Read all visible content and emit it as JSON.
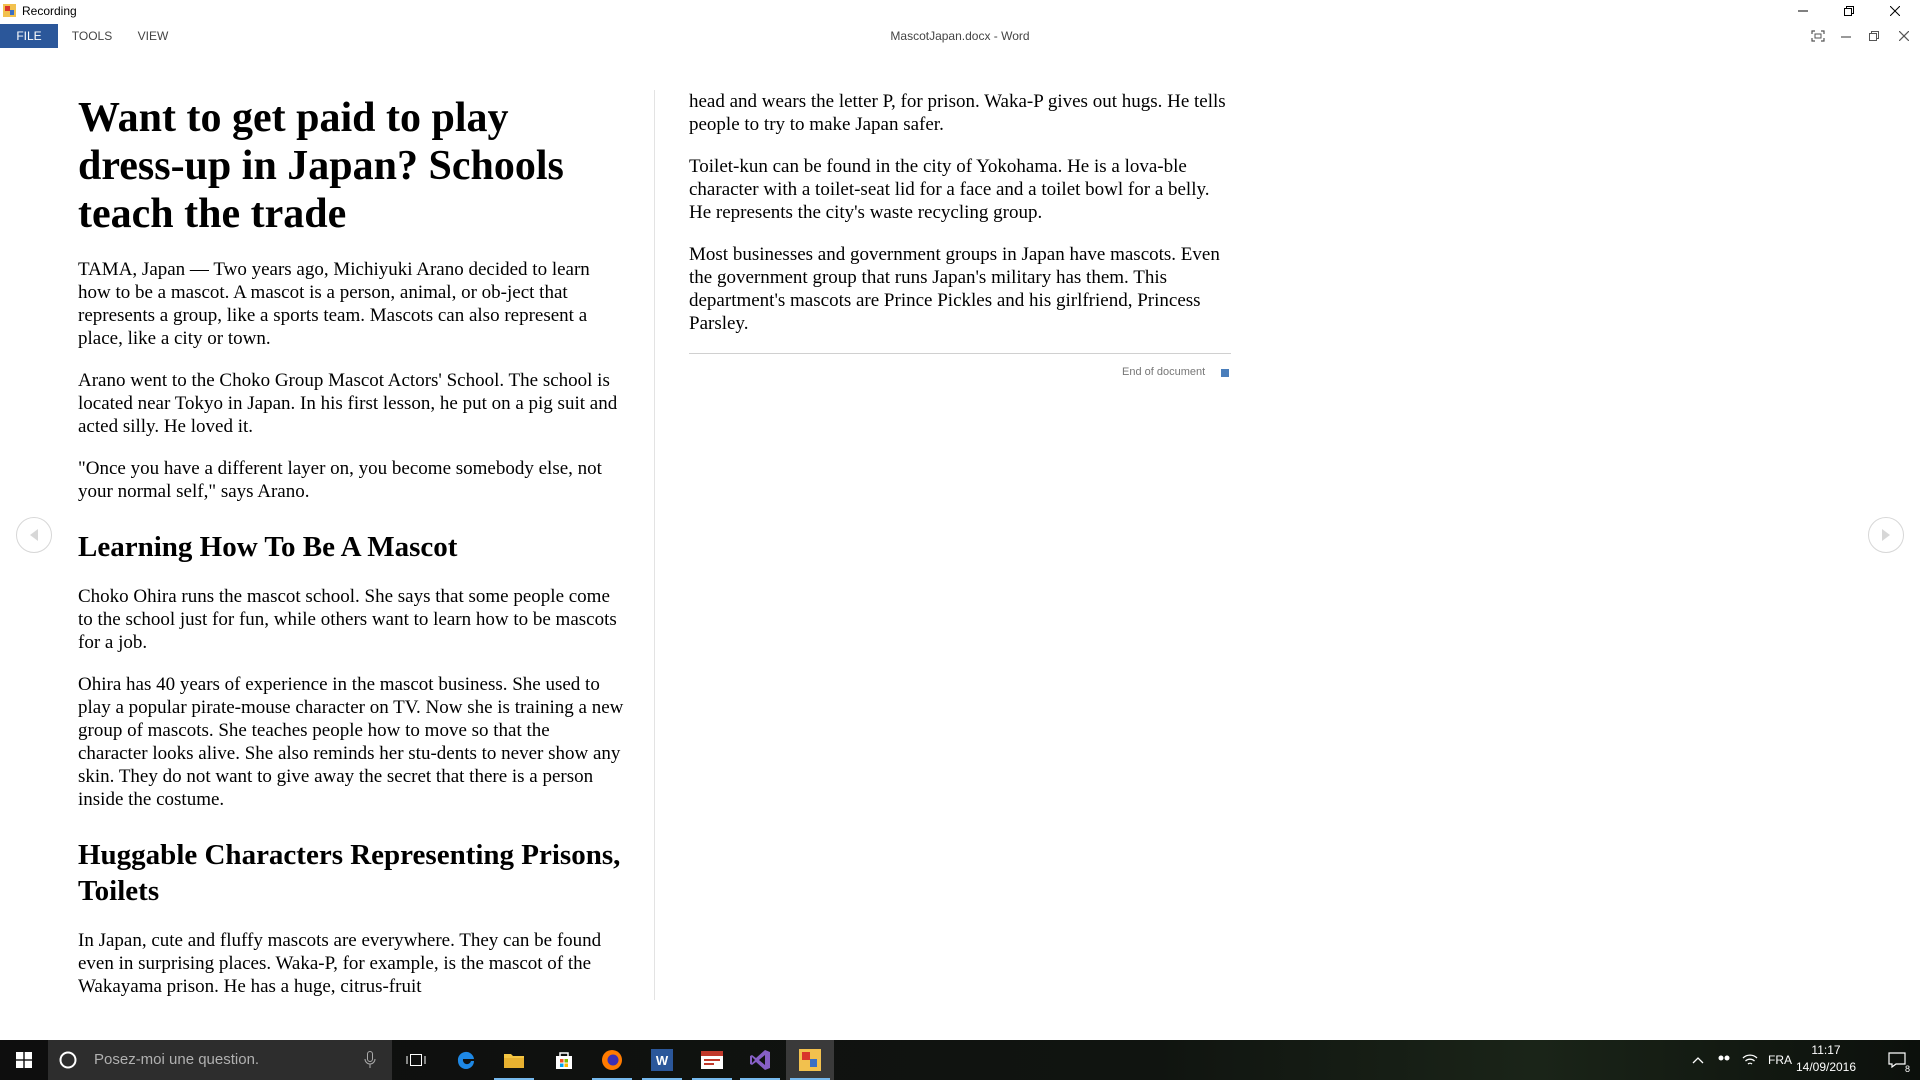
{
  "recording_window": {
    "title": "Recording"
  },
  "menu": {
    "file": "FILE",
    "tools": "TOOLS",
    "view": "VIEW",
    "doc_title": "MascotJapan.docx - Word"
  },
  "document": {
    "title": "Want to get paid to play dress-up in Japan? Schools teach the trade",
    "p1": "TAMA, Japan — Two years ago, Michiyuki Arano decided to learn how to be a mascot. A mascot is a person, animal, or ob-ject that represents a group, like a sports team. Mascots can also represent a place, like a city or town.",
    "p2": "Arano went to the Choko Group Mascot Actors' School. The school is located near Tokyo in Japan. In his first lesson, he put on a pig suit and acted silly. He loved it.",
    "p3": "\"Once you have a different layer on, you become somebody else, not your normal self,\" says Arano.",
    "h2a": "Learning How To Be A Mascot",
    "p4": "Choko Ohira runs the mascot school. She says that some people come to the school just for fun, while others want to learn how to be mascots for a job.",
    "p5": "Ohira has 40 years of experience in the mascot business. She used to play a popular pirate-mouse character on TV. Now she is training a new group of mascots. She teaches people how to move so that the character looks alive. She also reminds her stu-dents to never show any skin. They do not want to give away the secret that there is a person inside the costume.",
    "h2b": "Huggable Characters Representing Prisons, Toilets",
    "p6": "In Japan, cute and fluffy mascots are everywhere. They can be found even in surprising places. Waka-P, for example, is the mascot of the Wakayama prison. He has a huge, citrus-fruit",
    "r1": "head and wears the letter P, for prison. Waka-P gives out hugs. He tells people to try to make Japan safer.",
    "r2": "Toilet-kun can be found in the city of Yokohama. He is a lova-ble character with a toilet-seat lid for a face and a toilet bowl for a belly. He represents the city's waste recycling group.",
    "r3": "Most businesses and government groups in Japan have mascots. Even the government group that runs Japan's military has them. This department's mascots are Prince Pickles and his girlfriend, Princess Parsley.",
    "end_label": "End of document"
  },
  "taskbar": {
    "search_placeholder": "Posez-moi une question.",
    "language": "FRA",
    "time": "11:17",
    "date": "14/09/2016",
    "notification_count": "8"
  },
  "colors": {
    "accent": "#2b579a",
    "end_marker": "#4a7ebb",
    "taskbar_active": "#76b9ed"
  }
}
